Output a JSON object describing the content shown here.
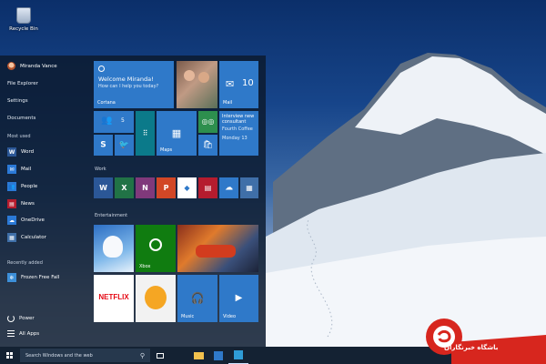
{
  "desktop": {
    "recycle_bin_label": "Recycle Bin",
    "accent_color": "#2f79c9"
  },
  "start_menu": {
    "user_name": "Miranda Vance",
    "nav": [
      "File Explorer",
      "Settings",
      "Documents"
    ],
    "most_used_heading": "Most used",
    "most_used": [
      {
        "label": "Word",
        "icon": "word-icon",
        "color": "#2b5797"
      },
      {
        "label": "Mail",
        "icon": "mail-icon",
        "color": "#2f79c9"
      },
      {
        "label": "People",
        "icon": "people-icon",
        "color": "#2f79c9"
      },
      {
        "label": "News",
        "icon": "news-icon",
        "color": "#b51c2e"
      },
      {
        "label": "OneDrive",
        "icon": "onedrive-icon",
        "color": "#2f79c9"
      },
      {
        "label": "Calculator",
        "icon": "calculator-icon",
        "color": "#3f6fa8"
      }
    ],
    "recently_added_heading": "Recently added",
    "recently_added": [
      {
        "label": "Frozen Free Fall",
        "icon": "frozen-free-fall-icon"
      }
    ],
    "power_label": "Power",
    "all_apps_label": "All Apps"
  },
  "tiles": {
    "cortana": {
      "headline": "Welcome Miranda!",
      "subtext": "How can I help you today?",
      "label": "Cortana"
    },
    "photos": {
      "icon": "photo-tile"
    },
    "mail": {
      "count": "10",
      "label": "Mail"
    },
    "people": {
      "badge": "5",
      "icon": "people-icon"
    },
    "skype": {
      "icon": "skype-icon"
    },
    "twitter": {
      "icon": "twitter-icon"
    },
    "phone": {
      "icon": "phone-dialpad-icon"
    },
    "maps": {
      "label": "Maps",
      "icon": "maps-icon"
    },
    "tripadvisor": {
      "icon": "tripadvisor-icon"
    },
    "store": {
      "icon": "store-icon"
    },
    "calendar": {
      "title": "Interview new consultant",
      "location": "Fourth Coffee",
      "date": "Monday 13"
    },
    "work_heading": "Work",
    "work": [
      {
        "icon": "word-icon",
        "color": "#2b5797"
      },
      {
        "icon": "excel-icon",
        "color": "#217346"
      },
      {
        "icon": "onenote-icon",
        "color": "#80397b"
      },
      {
        "icon": "powerpoint-icon",
        "color": "#d24726"
      },
      {
        "icon": "remote-desktop-icon",
        "color": "#ffffff"
      },
      {
        "icon": "news-icon",
        "color": "#b51c2e"
      },
      {
        "icon": "onedrive-icon",
        "color": "#2f79c9"
      },
      {
        "icon": "calculator-icon",
        "color": "#3f6fa8"
      }
    ],
    "entertainment_heading": "Entertainment",
    "frozen": {
      "icon": "frozen-game-tile"
    },
    "xbox": {
      "label": "Xbox",
      "icon": "xbox-icon"
    },
    "asphalt": {
      "icon": "racing-game-tile"
    },
    "netflix": {
      "text": "NETFLIX"
    },
    "game2": {
      "icon": "bird-game-tile"
    },
    "music": {
      "label": "Music",
      "icon": "headphones-icon"
    },
    "video": {
      "label": "Video",
      "icon": "play-icon"
    }
  },
  "taskbar": {
    "search_placeholder": "Search Windows and the web",
    "icons": [
      "task-view-icon",
      "file-explorer-icon",
      "edge-icon",
      "store-icon"
    ]
  },
  "watermark": {
    "text": "باشگاه خبرنگاران"
  }
}
